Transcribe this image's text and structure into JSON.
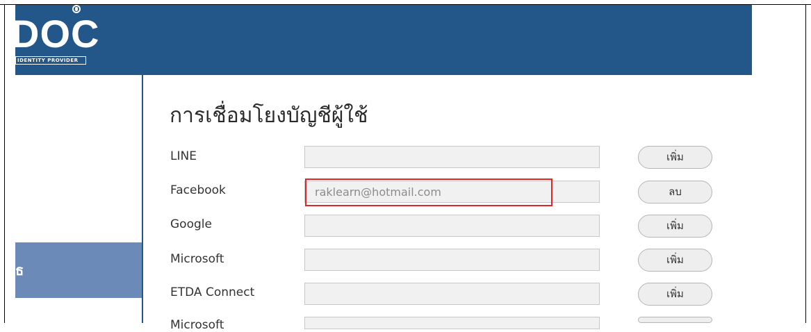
{
  "header": {
    "logo_text": "DOC",
    "logo_subtitle": "IDENTITY PROVIDER",
    "brand_color": "#235689"
  },
  "sidebar": {
    "active_item_label": "ธ",
    "active_color": "#6b8ab8"
  },
  "main": {
    "title": "การเชื่อมโยงบัญชีผู้ใช้",
    "accounts": [
      {
        "provider": "LINE",
        "value": "",
        "action": "เพิ่ม"
      },
      {
        "provider": "Facebook",
        "value": "raklearn@hotmail.com",
        "action": "ลบ"
      },
      {
        "provider": "Google",
        "value": "",
        "action": "เพิ่ม"
      },
      {
        "provider": "Microsoft",
        "value": "",
        "action": "เพิ่ม"
      },
      {
        "provider": "ETDA Connect",
        "value": "",
        "action": "เพิ่ม"
      },
      {
        "provider": "Microsoft",
        "value": "",
        "action": ""
      }
    ]
  },
  "annotation": {
    "highlight_color": "#e02626"
  }
}
